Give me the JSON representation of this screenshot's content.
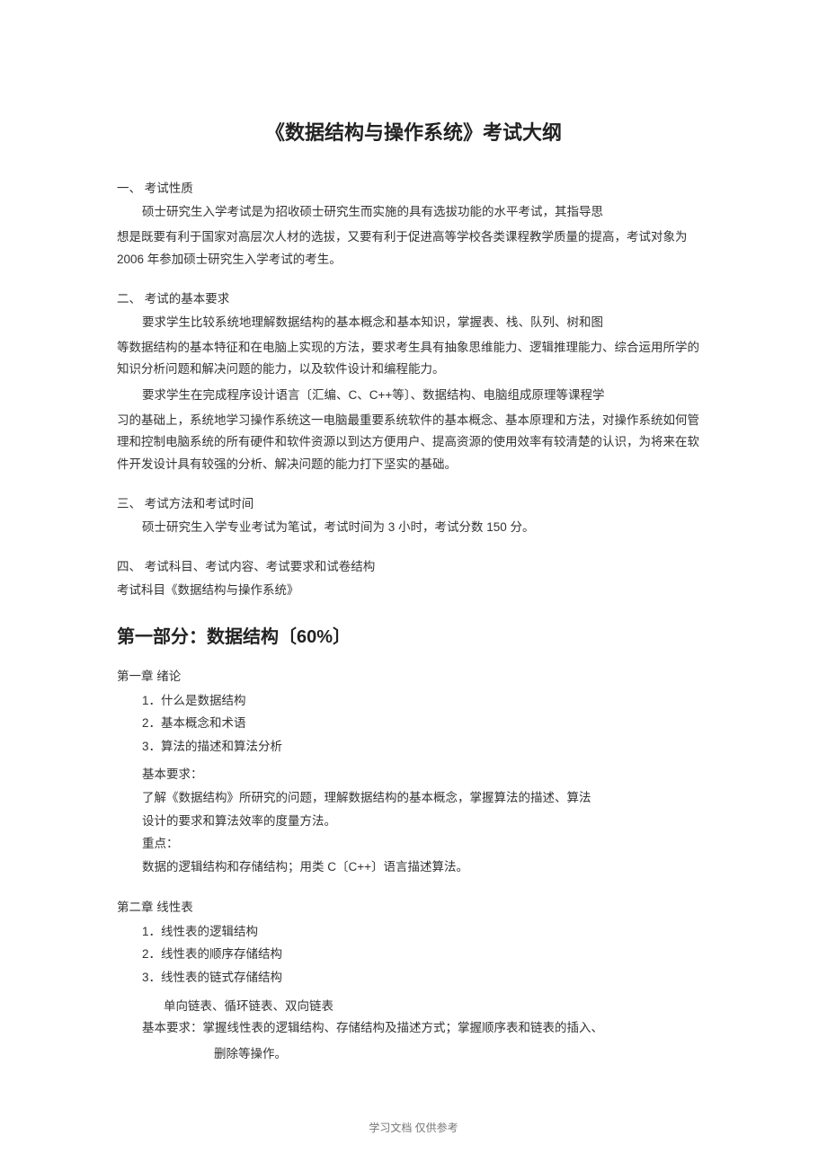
{
  "title": "《数据结构与操作系统》考试大纲",
  "s1": {
    "head": "一、 考试性质",
    "p1": "硕士研究生入学考试是为招收硕士研究生而实施的具有选拔功能的水平考试，其指导思",
    "p2": "想是既要有利于国家对高层次人材的选拔，又要有利于促进高等学校各类课程教学质量的提高，考试对象为 2006 年参加硕士研究生入学考试的考生。"
  },
  "s2": {
    "head": "二、 考试的基本要求",
    "p1": "要求学生比较系统地理解数据结构的基本概念和基本知识，掌握表、栈、队列、树和图",
    "p2": "等数据结构的基本特征和在电脑上实现的方法，要求考生具有抽象思维能力、逻辑推理能力、综合运用所学的知识分析问题和解决问题的能力，以及软件设计和编程能力。",
    "p3": "要求学生在完成程序设计语言〔汇编、C、C++等〕、数据结构、电脑组成原理等课程学",
    "p4": "习的基础上，系统地学习操作系统这一电脑最重要系统软件的基本概念、基本原理和方法，对操作系统如何管理和控制电脑系统的所有硬件和软件资源以到达方便用户、提高资源的使用效率有较清楚的认识，为将来在软件开发设计具有较强的分析、解决问题的能力打下坚实的基础。"
  },
  "s3": {
    "head": "三、 考试方法和考试时间",
    "p1": "硕士研究生入学专业考试为笔试，考试时间为 3 小时，考试分数 150 分。"
  },
  "s4": {
    "head": "四、 考试科目、考试内容、考试要求和试卷结构",
    "p1": "考试科目《数据结构与操作系统》"
  },
  "part1": {
    "head": "第一部分：数据结构〔60%〕"
  },
  "ch1": {
    "head": "第一章 绪论",
    "i1": "1．什么是数据结构",
    "i2": "2．基本概念和术语",
    "i3": "3．算法的描述和算法分析",
    "req_label": "基本要求：",
    "req1": "了解《数据结构》所研究的问题，理解数据结构的基本概念，掌握算法的描述、算法",
    "req2": "设计的要求和算法效率的度量方法。",
    "focus_label": "重点：",
    "focus": "数据的逻辑结构和存储结构；用类 C〔C++〕语言描述算法。"
  },
  "ch2": {
    "head": "第二章 线性表",
    "i1": "1．线性表的逻辑结构",
    "i2": "2．线性表的顺序存储结构",
    "i3": "3．线性表的链式存储结构",
    "sub": "单向链表、循环链表、双向链表",
    "req1": "基本要求：掌握线性表的逻辑结构、存储结构及描述方式；掌握顺序表和链表的插入、",
    "req2": "删除等操作。"
  },
  "footer": "学习文档 仅供参考"
}
